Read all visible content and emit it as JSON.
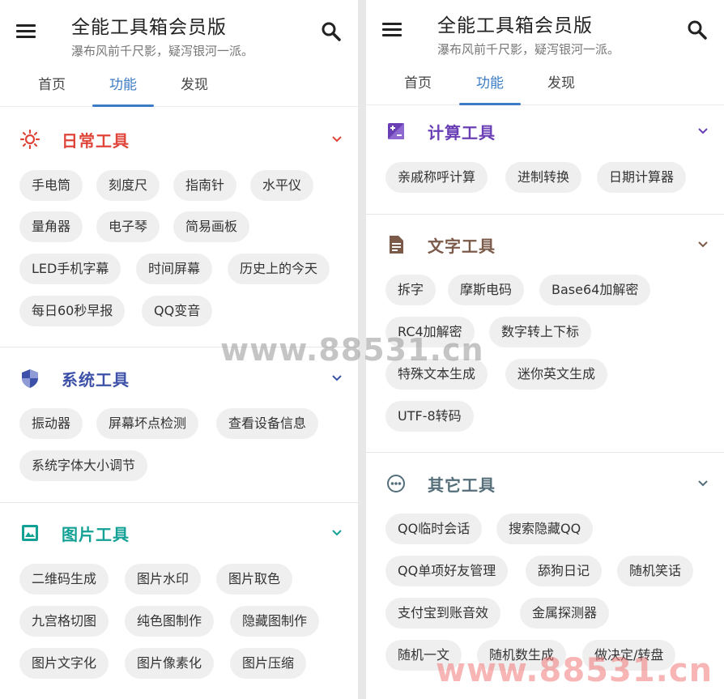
{
  "app": {
    "title": "全能工具箱会员版",
    "subtitle": "瀑布风前千尺影，疑泻银河一派。",
    "menu_icon": "hamburger-menu-icon",
    "search_icon": "search-icon",
    "tabs": [
      "首页",
      "功能",
      "发现"
    ],
    "active_tab": "功能"
  },
  "left": {
    "sections": [
      {
        "title": "日常工具",
        "color": "#e0453a",
        "icon": "sun-icon",
        "expanded": true,
        "items": [
          "手电筒",
          "刻度尺",
          "指南针",
          "水平仪",
          "量角器",
          "电子琴",
          "简易画板",
          "LED手机字幕",
          "时间屏幕",
          "历史上的今天",
          "每日60秒早报",
          "QQ变音"
        ]
      },
      {
        "title": "系统工具",
        "color": "#3d51a8",
        "icon": "shield-icon",
        "expanded": true,
        "items": [
          "振动器",
          "屏幕坏点检测",
          "查看设备信息",
          "系统字体大小调节"
        ]
      },
      {
        "title": "图片工具",
        "color": "#13a196",
        "icon": "image-icon",
        "expanded": true,
        "items": [
          "二维码生成",
          "图片水印",
          "图片取色",
          "九宫格切图",
          "纯色图制作",
          "隐藏图制作",
          "图片文字化",
          "图片像素化",
          "图片压缩"
        ]
      }
    ]
  },
  "right": {
    "sections": [
      {
        "title": "计算工具",
        "color": "#6a3fb5",
        "icon": "calculator-icon",
        "expanded": true,
        "items": [
          "亲戚称呼计算",
          "进制转换",
          "日期计算器"
        ]
      },
      {
        "title": "文字工具",
        "color": "#7b5a4a",
        "icon": "document-icon",
        "expanded": true,
        "items": [
          "拆字",
          "摩斯电码",
          "Base64加解密",
          "RC4加解密",
          "数字转上下标",
          "特殊文本生成",
          "迷你英文生成",
          "UTF-8转码"
        ]
      },
      {
        "title": "其它工具",
        "color": "#546e7a",
        "icon": "more-dots-icon",
        "expanded": true,
        "items": [
          "QQ临时会话",
          "搜索隐藏QQ",
          "QQ单项好友管理",
          "舔狗日记",
          "随机笑话",
          "支付宝到账音效",
          "金属探测器",
          "随机一文",
          "随机数生成",
          "做决定/转盘"
        ]
      }
    ]
  },
  "watermarks": [
    "www.88531.cn",
    "www.88531.cn"
  ]
}
